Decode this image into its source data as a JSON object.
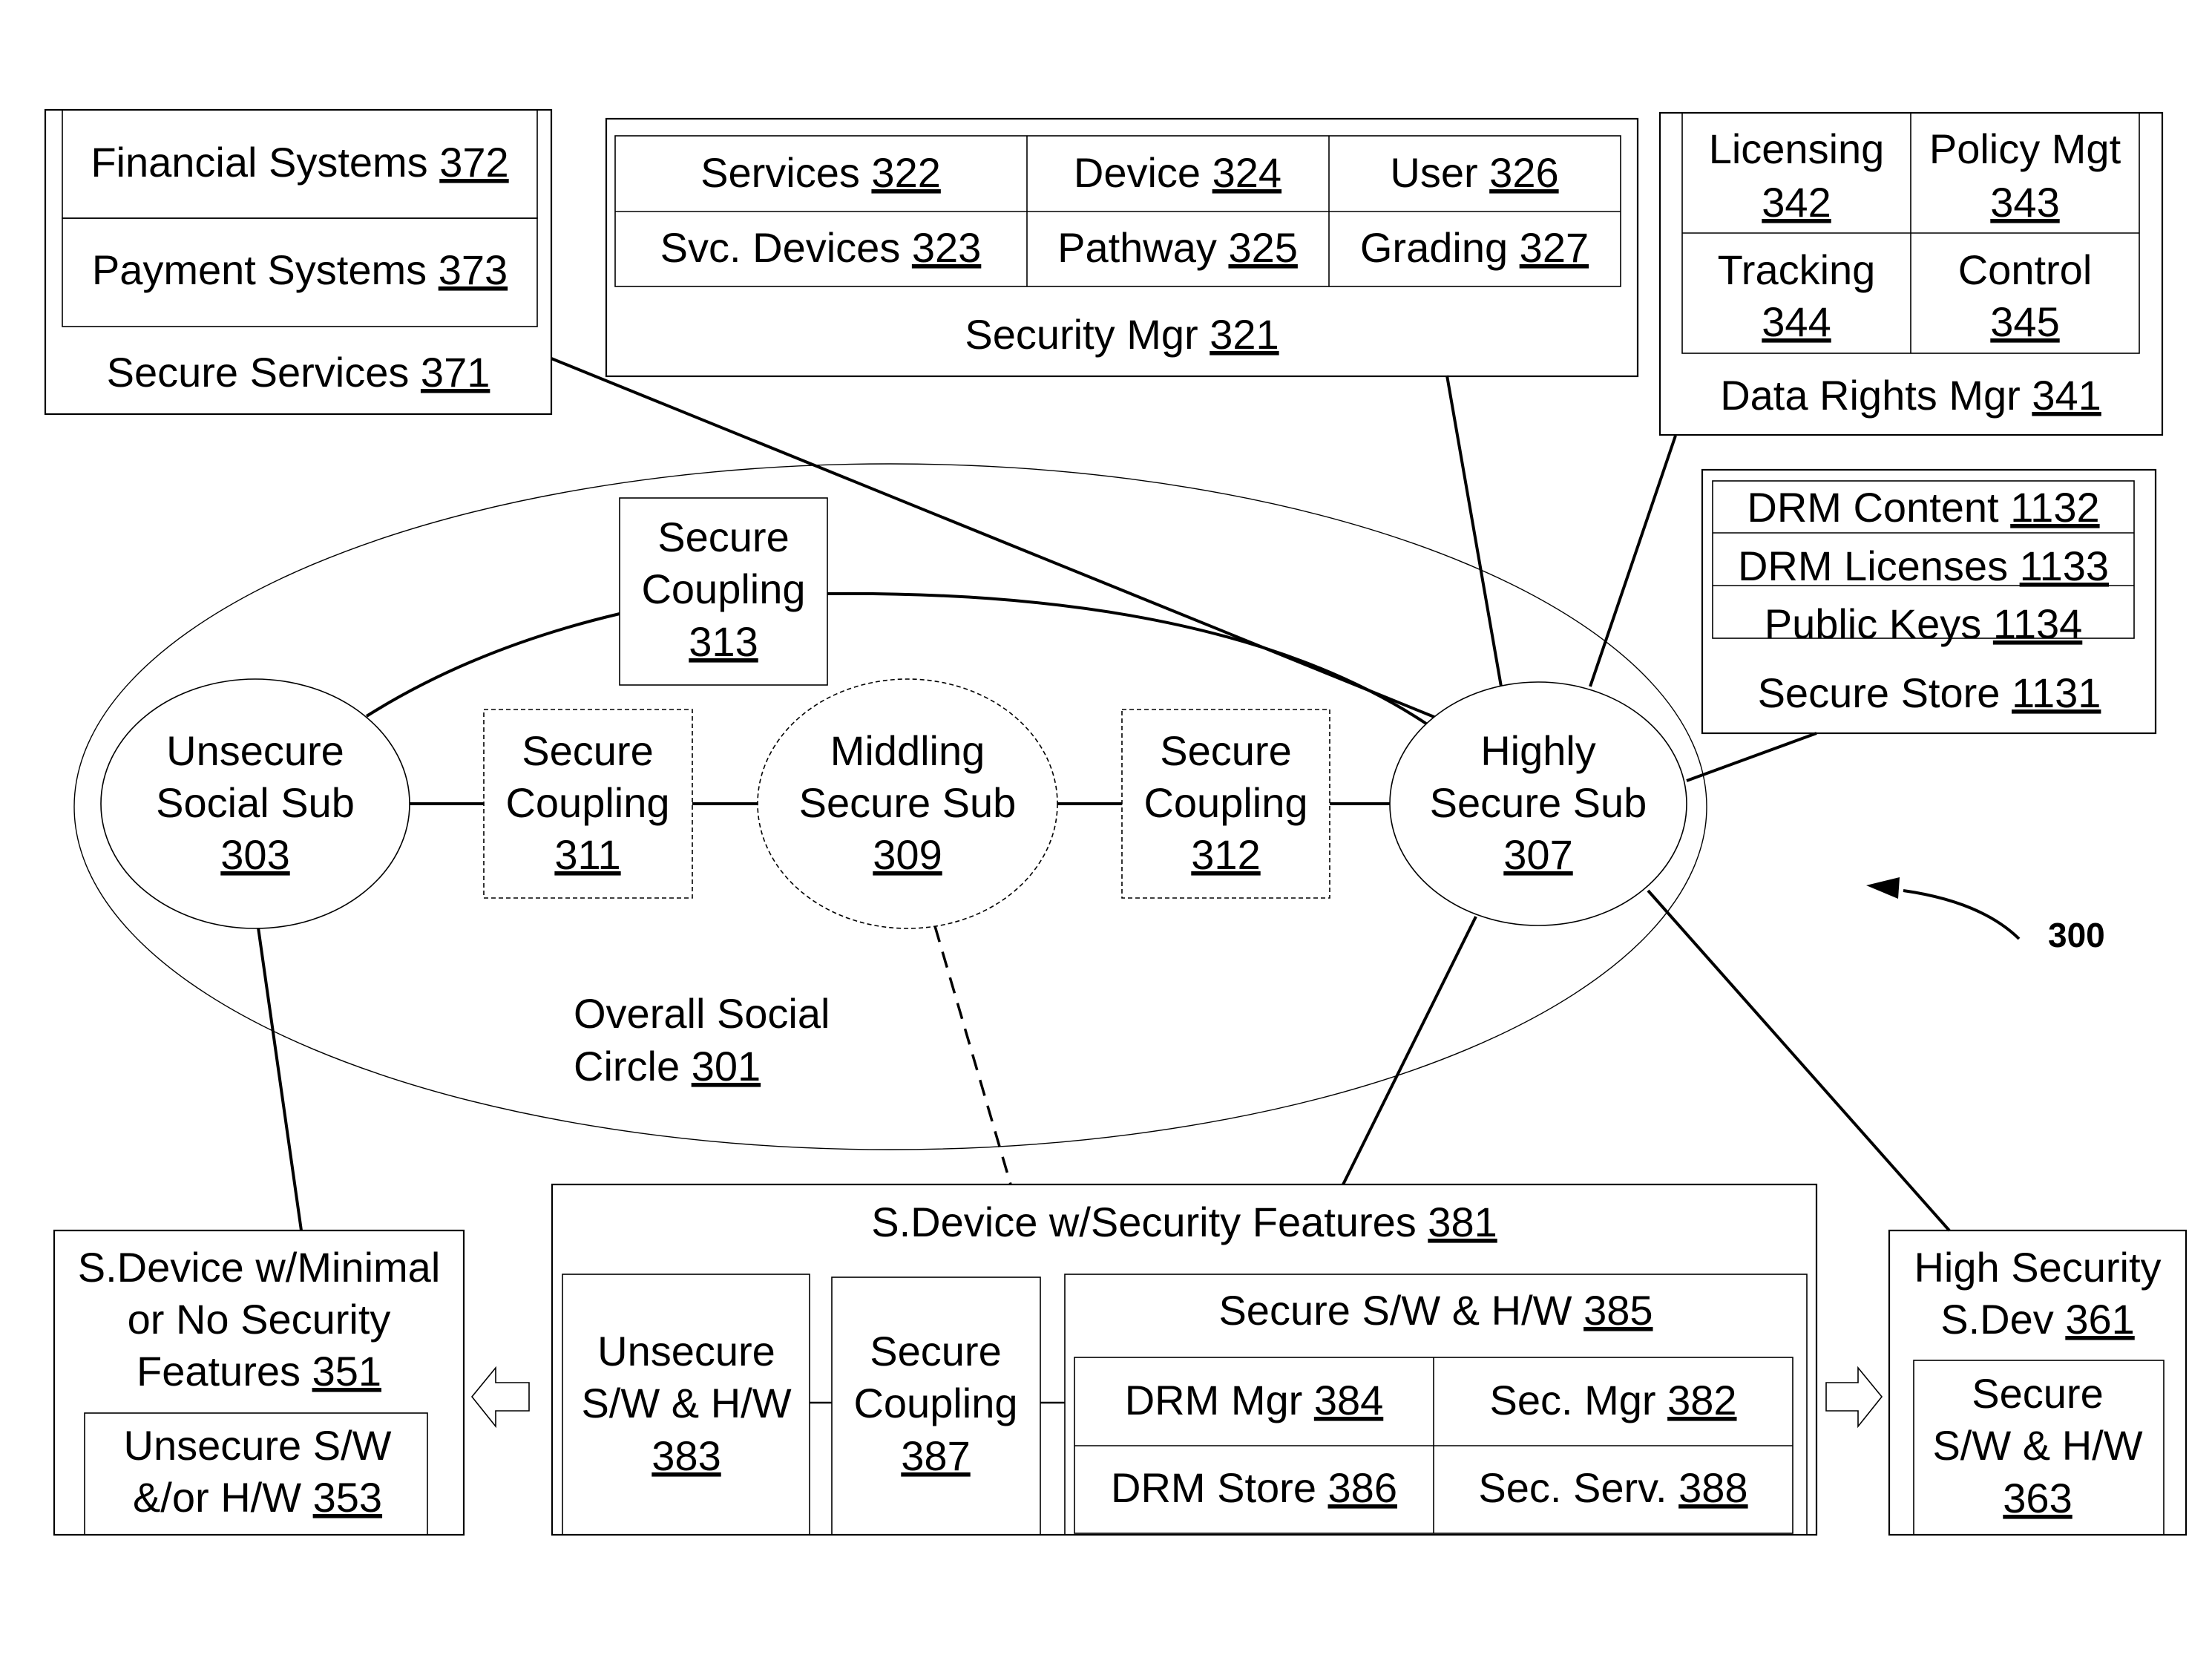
{
  "figure": {
    "reference_number": "300"
  },
  "social_circle": {
    "label_line1": "Overall Social",
    "label_line2": "Circle ",
    "number": "301"
  },
  "subs": {
    "unsecure": {
      "line1": "Unsecure",
      "line2": "Social Sub",
      "number": "303"
    },
    "middling": {
      "line1": "Middling",
      "line2": "Secure Sub",
      "number": "309"
    },
    "highly": {
      "line1": "Highly",
      "line2": "Secure Sub",
      "number": "307"
    }
  },
  "couplings": {
    "c311": {
      "line1": "Secure",
      "line2": "Coupling",
      "number": "311"
    },
    "c312": {
      "line1": "Secure",
      "line2": "Coupling",
      "number": "312"
    },
    "c313": {
      "line1": "Secure",
      "line2": "Coupling",
      "number": "313"
    }
  },
  "secure_services": {
    "title": "Secure Services ",
    "number": "371",
    "items": [
      {
        "label": "Financial Systems ",
        "number": "372"
      },
      {
        "label": "Payment Systems ",
        "number": "373"
      }
    ]
  },
  "security_mgr": {
    "title": "Security Mgr ",
    "number": "321",
    "cells": [
      {
        "label": "Services ",
        "number": "322"
      },
      {
        "label": "Device ",
        "number": "324"
      },
      {
        "label": "User ",
        "number": "326"
      },
      {
        "label": "Svc. Devices ",
        "number": "323"
      },
      {
        "label": "Pathway ",
        "number": "325"
      },
      {
        "label": "Grading ",
        "number": "327"
      }
    ]
  },
  "data_rights_mgr": {
    "title": "Data Rights Mgr ",
    "number": "341",
    "cells": [
      {
        "label": "Licensing",
        "number": "342"
      },
      {
        "label": "Policy Mgt",
        "number": "343"
      },
      {
        "label": "Tracking",
        "number": "344"
      },
      {
        "label": "Control",
        "number": "345"
      }
    ]
  },
  "secure_store": {
    "title": "Secure Store ",
    "number": "1131",
    "items": [
      {
        "label": "DRM Content ",
        "number": "1132"
      },
      {
        "label": "DRM Licenses ",
        "number": "1133"
      },
      {
        "label": "Public Keys ",
        "number": "1134"
      }
    ]
  },
  "minimal_device": {
    "line1": "S.Device w/Minimal",
    "line2": "or No Security",
    "line3": "Features ",
    "number": "351",
    "inner": {
      "line1": "Unsecure S/W",
      "line2": "&/or H/W ",
      "number": "353"
    }
  },
  "security_device": {
    "title": "S.Device w/Security Features ",
    "number": "381",
    "unsecure_hw": {
      "line1": "Unsecure",
      "line2": "S/W & H/W",
      "number": "383"
    },
    "coupling": {
      "line1": "Secure",
      "line2": "Coupling",
      "number": "387"
    },
    "secure_hw": {
      "title": "Secure S/W & H/W ",
      "number": "385",
      "cells": [
        {
          "label": "DRM Mgr ",
          "number": "384"
        },
        {
          "label": "Sec. Mgr ",
          "number": "382"
        },
        {
          "label": "DRM Store ",
          "number": "386"
        },
        {
          "label": "Sec. Serv. ",
          "number": "388"
        }
      ]
    }
  },
  "high_security_device": {
    "line1": "High Security",
    "line2": "S.Dev ",
    "number": "361",
    "inner": {
      "line1": "Secure",
      "line2": "S/W & H/W",
      "number": "363"
    }
  }
}
